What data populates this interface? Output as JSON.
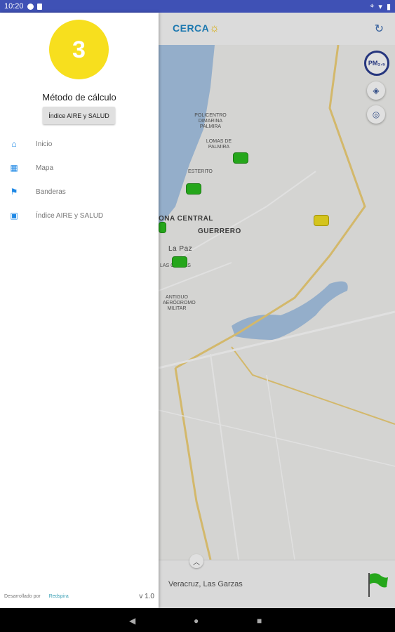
{
  "status_bar": {
    "time": "10:20"
  },
  "app_bar": {
    "logo_text": "CERCA",
    "refresh_icon": "refresh-icon"
  },
  "drawer": {
    "logo_text": "3",
    "method_title": "Método de cálculo",
    "method_button": "Índice AIRE y SALUD",
    "nav_items": [
      {
        "label": "Inicio",
        "icon": "home-icon"
      },
      {
        "label": "Mapa",
        "icon": "map-icon"
      },
      {
        "label": "Banderas",
        "icon": "flag-icon"
      },
      {
        "label": "Índice AIRE y SALUD",
        "icon": "book-icon"
      }
    ],
    "footer_label": "Desarrollado por",
    "footer_brand": "Redspira",
    "version": "v 1.0"
  },
  "map": {
    "labels": {
      "policentro": "POLICENTRO DIMARINA PALMIRA",
      "lomas": "LOMAS DE PALMIRA",
      "esterito": "ESTERITO",
      "zona_central": "ONA CENTRAL",
      "guerrero": "GUERRERO",
      "la_paz": "La Paz",
      "las_garzas": "LAS GARZAS",
      "aerodromo": "ANTIGUO AERÓDROMO MILITAR"
    },
    "pm_button": "PM₂.₅",
    "place_name": "Veracruz, Las Garzas"
  },
  "colors": {
    "accent": "#3f51b5",
    "good": "#2bbd1f",
    "moderate": "#f2e021",
    "logo_yellow": "#f7df1e"
  }
}
